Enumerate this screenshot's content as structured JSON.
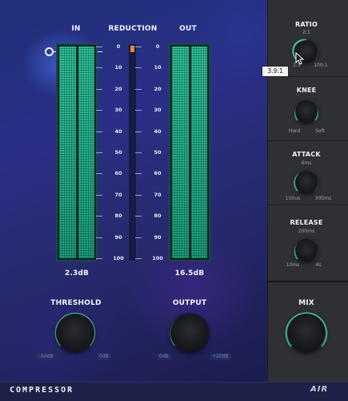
{
  "meters": {
    "in_label": "IN",
    "reduction_label": "REDUCTION",
    "out_label": "OUT",
    "in_value": "2.3dB",
    "out_value": "16.5dB",
    "scale": [
      "0",
      "10",
      "20",
      "30",
      "40",
      "50",
      "60",
      "70",
      "80",
      "90",
      "100"
    ],
    "in_level": 1.0,
    "out_level": 1.0,
    "reduction_level": 0.03
  },
  "threshold": {
    "label": "THRESHOLD",
    "min": "-50dB",
    "max": "0dB"
  },
  "output": {
    "label": "OUTPUT",
    "min": "0dB",
    "max": "+20dB"
  },
  "ratio": {
    "label": "RATIO",
    "top": "2:1",
    "min": "1:1",
    "max": "100:1",
    "tooltip": "3.9:1"
  },
  "knee": {
    "label": "KNEE",
    "min": "Hard",
    "max": "Soft"
  },
  "attack": {
    "label": "ATTACK",
    "top": "6ms",
    "min": "100us",
    "max": "300ms"
  },
  "release": {
    "label": "RELEASE",
    "top": "200ms",
    "min": "10ms",
    "max": "4s"
  },
  "mix": {
    "label": "MIX"
  },
  "footer": {
    "title": "COMPRESSOR",
    "brand": "AIR"
  },
  "colors": {
    "accent": "#4fd6b0",
    "meter": "#2ec59b",
    "panel": "#2f3033"
  }
}
